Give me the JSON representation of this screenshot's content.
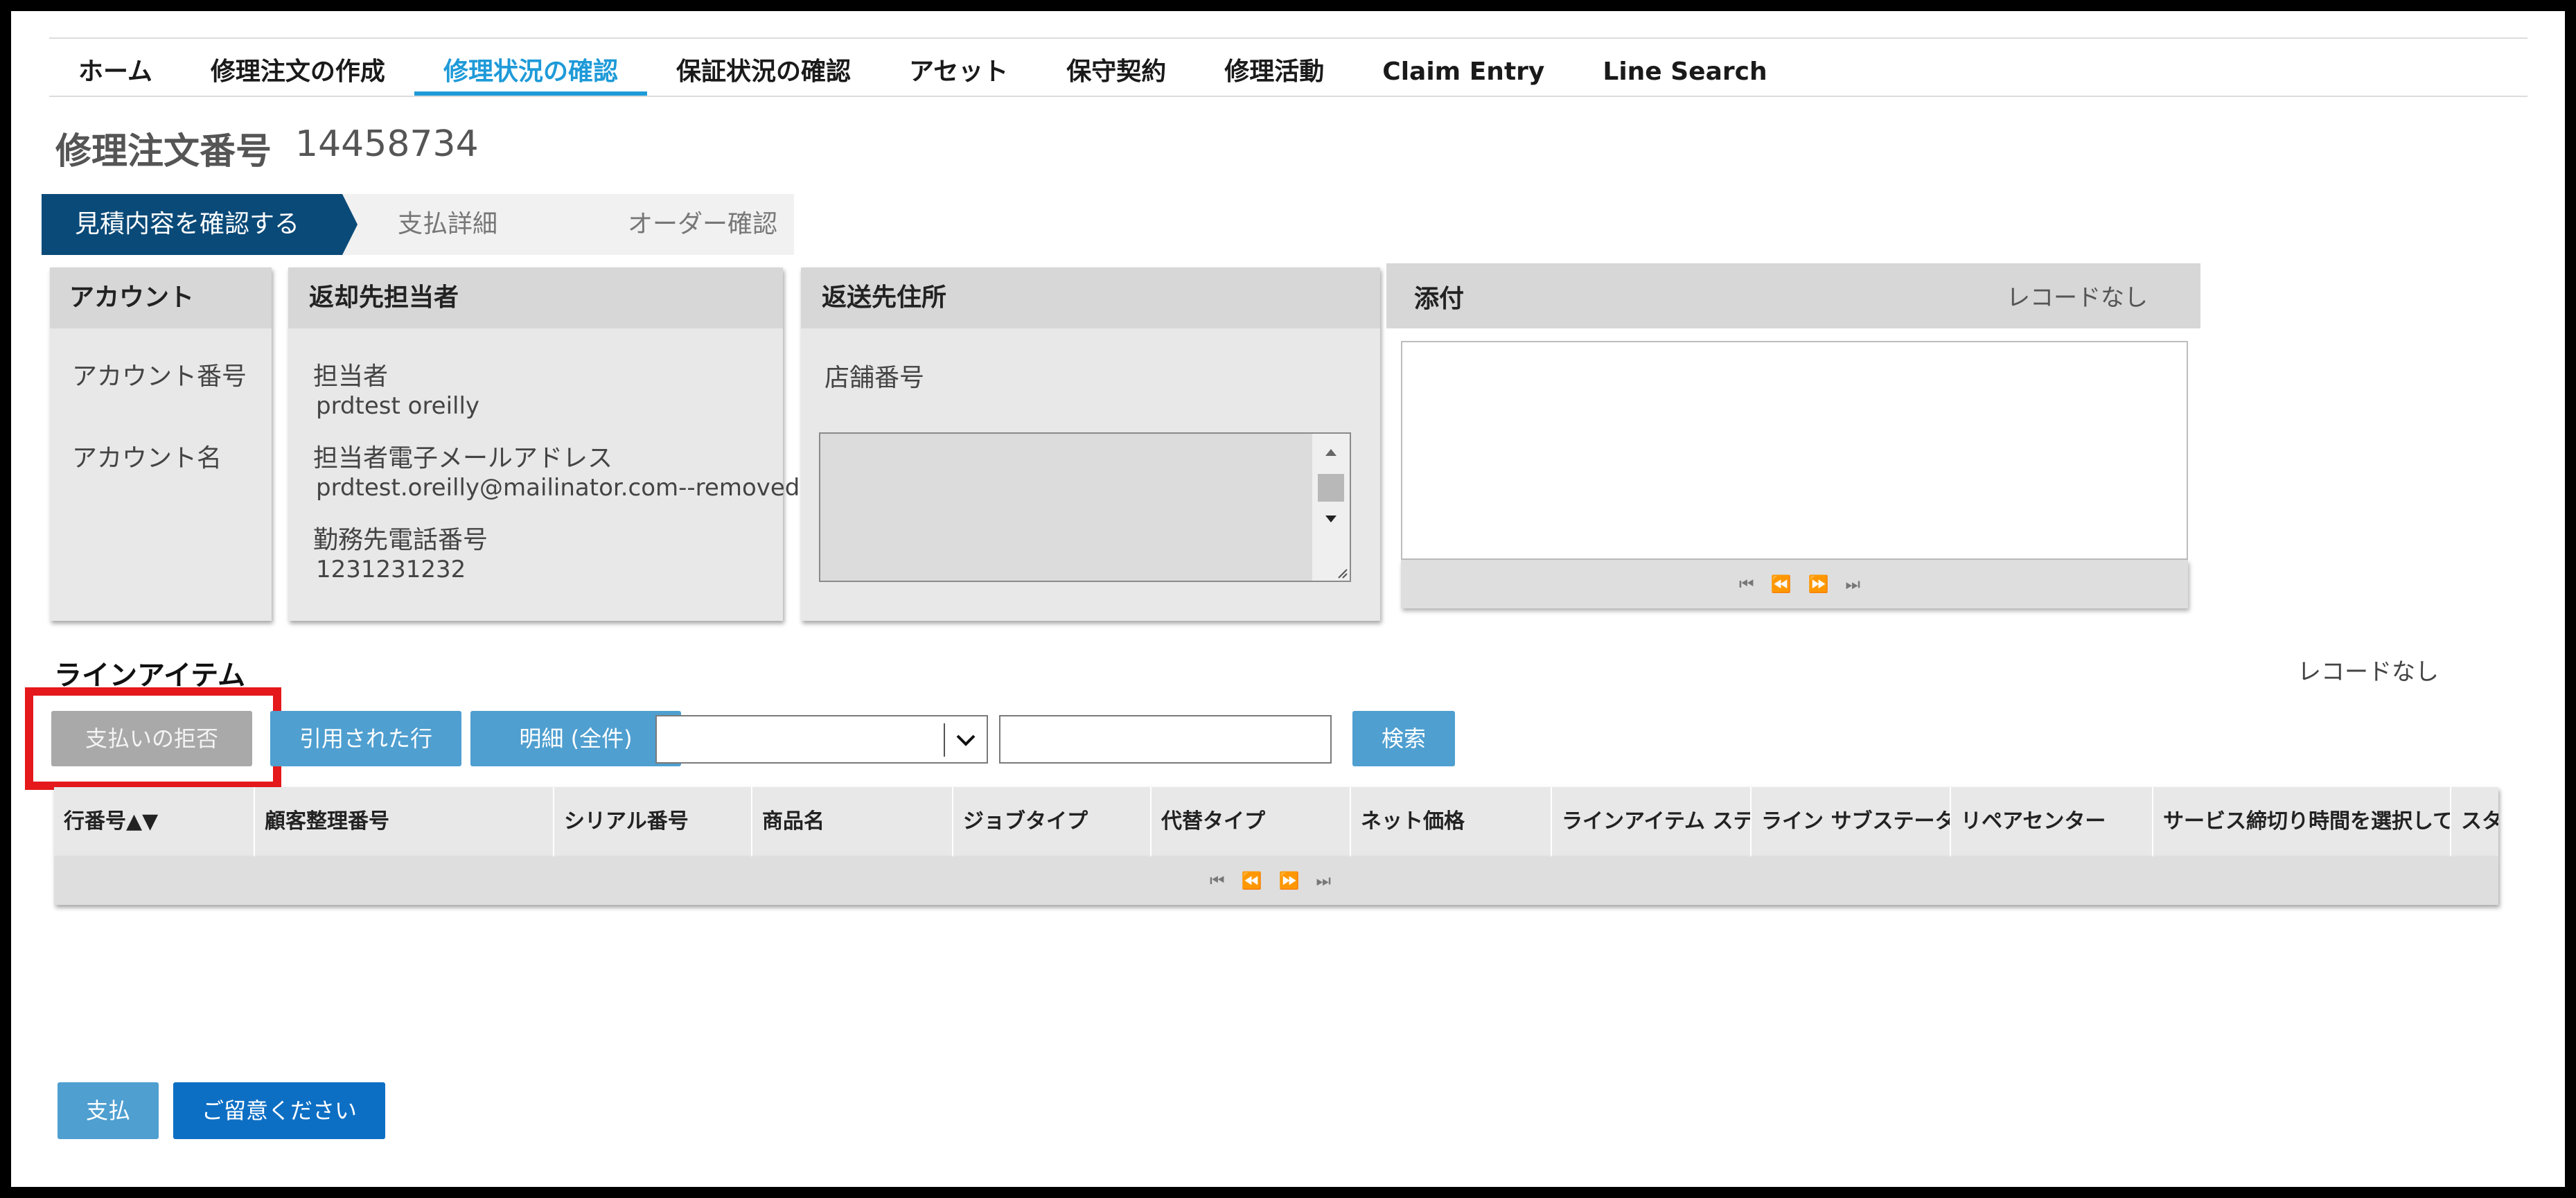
{
  "nav": {
    "items": [
      {
        "label": "ホーム",
        "active": false
      },
      {
        "label": "修理注文の作成",
        "active": false
      },
      {
        "label": "修理状況の確認",
        "active": true
      },
      {
        "label": "保証状況の確認",
        "active": false
      },
      {
        "label": "アセット",
        "active": false
      },
      {
        "label": "保守契約",
        "active": false
      },
      {
        "label": "修理活動",
        "active": false
      },
      {
        "label": "Claim Entry",
        "active": false
      },
      {
        "label": "Line Search",
        "active": false
      }
    ]
  },
  "header": {
    "title_label": "修理注文番号",
    "order_number": "14458734"
  },
  "steps": [
    {
      "label": "見積内容を確認する",
      "active": true
    },
    {
      "label": "支払詳細",
      "active": false
    },
    {
      "label": "オーダー確認",
      "active": false
    }
  ],
  "account_panel": {
    "title": "アカウント",
    "account_number_label": "アカウント番号",
    "account_name_label": "アカウント名"
  },
  "contact_panel": {
    "title": "返却先担当者",
    "person_label": "担当者",
    "person_value": "prdtest oreilly",
    "email_label": "担当者電子メールアドレス",
    "email_value": "prdtest.oreilly@mailinator.com--removed",
    "phone_label": "勤務先電話番号",
    "phone_value": "1231231232"
  },
  "address_panel": {
    "title": "返送先住所",
    "store_label": "店舗番号"
  },
  "attachment_panel": {
    "title": "添付",
    "no_records": "レコードなし"
  },
  "pager_icons": [
    "first-page-icon",
    "prev-page-icon",
    "next-page-icon",
    "last-page-icon"
  ],
  "line_items": {
    "title": "ラインアイテム",
    "no_records": "レコードなし",
    "buttons": {
      "reject_payment": "支払いの拒否",
      "quoted_lines": "引用された行",
      "details_all": "明細 (全件)",
      "search": "検索"
    },
    "columns": [
      "行番号▲▼",
      "顧客整理番号",
      "シリアル番号",
      "商品名",
      "ジョブタイプ",
      "代替タイプ",
      "ネット価格",
      "ラインアイテム ステ",
      "ライン サブステータ",
      "リペアセンター",
      "サービス締切り時間を選択して",
      "スタ"
    ]
  },
  "footer": {
    "pay_button": "支払",
    "note_button": "ご留意ください"
  },
  "colors": {
    "nav_active": "#1e9ad8",
    "step_active": "#0a4a78",
    "button_blue": "#4f9fd0",
    "button_primary": "#0d6fc4",
    "highlight": "#e5181b"
  }
}
